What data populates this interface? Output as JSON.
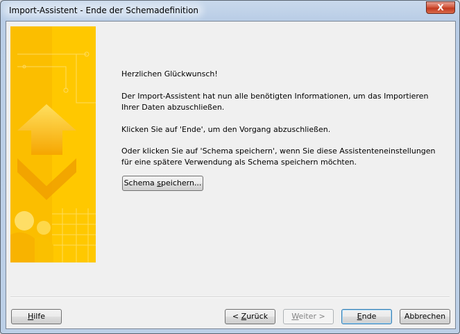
{
  "window": {
    "title": "Import-Assistent - Ende der Schemadefinition",
    "close_glyph": "X"
  },
  "content": {
    "greeting": "Herzlichen Glückwunsch!",
    "para1": "Der Import-Assistent hat nun alle benötigten Informationen, um das Importieren Ihrer Daten abzuschließen.",
    "para2": "Klicken Sie auf 'Ende', um den Vorgang abzuschließen.",
    "para3": "Oder klicken Sie auf 'Schema speichern', wenn Sie diese Assistenteneinstellungen für eine spätere Verwendung als Schema speichern möchten."
  },
  "buttons": {
    "save_schema": {
      "before": "Schema ",
      "mnemonic": "s",
      "after": "peichern..."
    },
    "help": {
      "before": "",
      "mnemonic": "H",
      "after": "ilfe"
    },
    "back": {
      "before": "< ",
      "mnemonic": "Z",
      "after": "urück"
    },
    "next": {
      "before": "",
      "mnemonic": "W",
      "after": "eiter >"
    },
    "finish": {
      "before": "",
      "mnemonic": "E",
      "after": "nde"
    },
    "cancel": {
      "before": "Abbrechen",
      "mnemonic": "",
      "after": ""
    }
  },
  "colors": {
    "banner_yellow": "#ffcc00",
    "banner_orange": "#f2a900",
    "default_button_border": "#3c7fb1"
  }
}
